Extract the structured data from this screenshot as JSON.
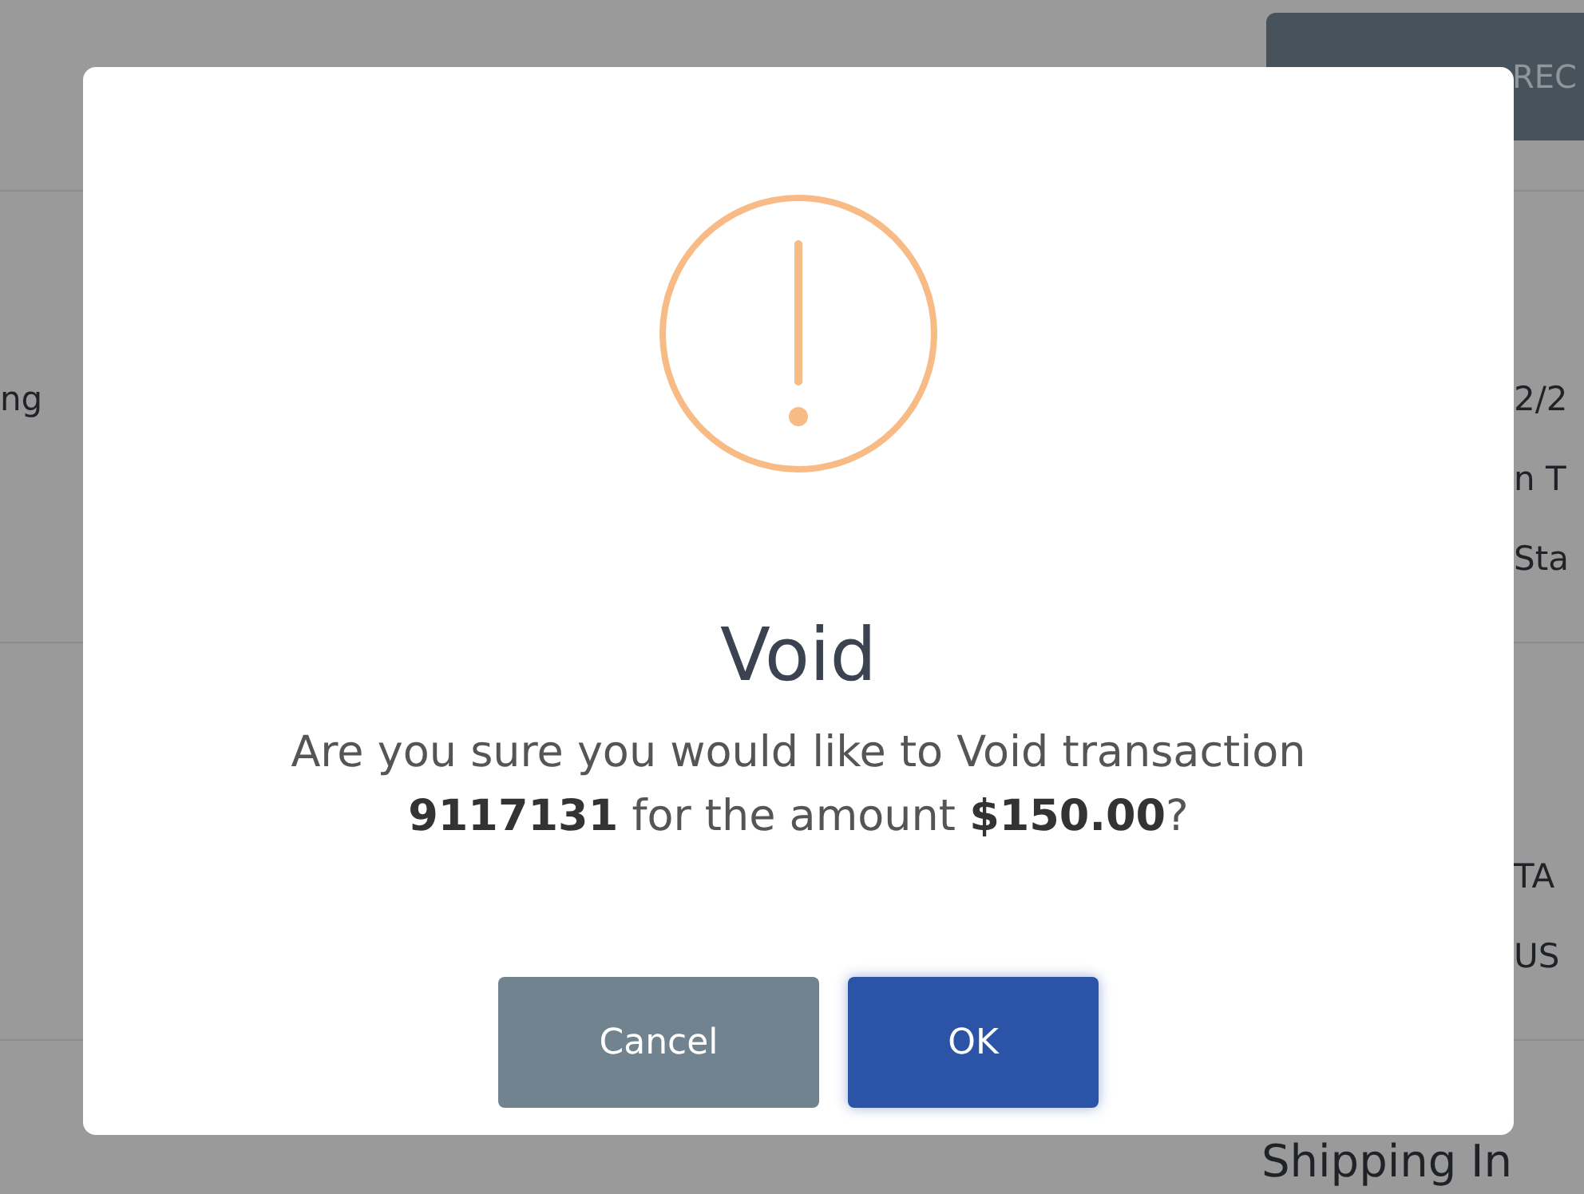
{
  "page": {
    "print_button": "REC",
    "left_fragments": [
      "ng"
    ],
    "right_fragments_top": [
      "2/2",
      "n T",
      "Sta"
    ],
    "right_fragments_middle": [
      "TA",
      "US"
    ],
    "section_heading": "Shipping In"
  },
  "dialog": {
    "title": "Void",
    "message": "Are you sure you would like to Void transaction **9117131** for the amount **$150.00**?",
    "buttons": [
      {
        "label": "Cancel",
        "kind": "secondary"
      },
      {
        "label": "OK",
        "kind": "primary"
      }
    ]
  }
}
